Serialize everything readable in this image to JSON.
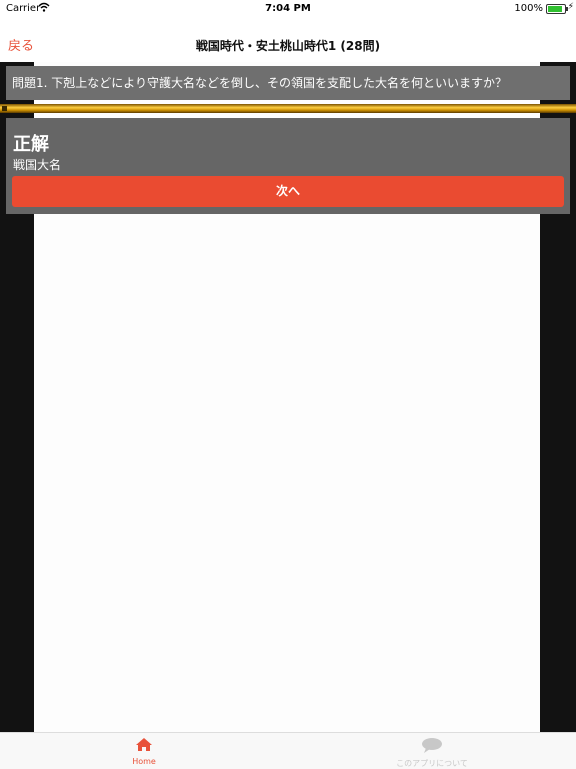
{
  "status": {
    "carrier": "Carrier",
    "time": "7:04 PM",
    "battery": "100%"
  },
  "nav": {
    "back": "戻る",
    "title": "戦国時代・安土桃山時代1 (28問)"
  },
  "question": {
    "text": "問題1. 下剋上などにより守護大名などを倒し、その領国を支配した大名を何といいますか？"
  },
  "answer": {
    "title": "正解",
    "text": "戦国大名"
  },
  "next_button": "次へ",
  "tabs": [
    {
      "label": "Home",
      "icon": "home-icon",
      "selected": true
    },
    {
      "label": "このアプリについて",
      "icon": "speech-bubble-icon",
      "selected": false
    }
  ],
  "colors": {
    "accent": "#e8523a",
    "button": "#ea4b31",
    "panel": "#666666"
  }
}
